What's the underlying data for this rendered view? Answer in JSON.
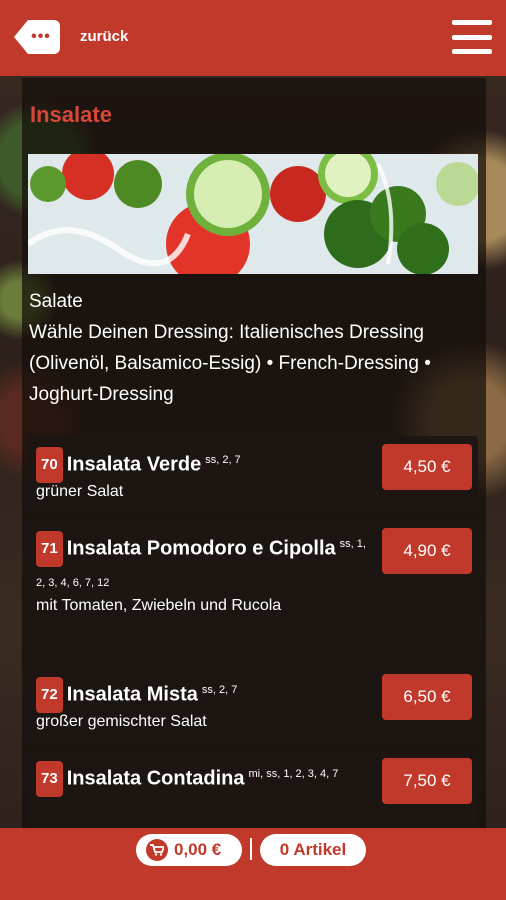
{
  "header": {
    "back_label": "zurück",
    "back_icon_text": "•••"
  },
  "section": {
    "title": "Insalate",
    "description": "Salate\nWähle Deinen Dressing: Italienisches Dressing (Olivenöl, Balsamico-Essig) • French-Dressing • Joghurt-Dressing"
  },
  "items": [
    {
      "number": "70",
      "name": "Insalata Verde",
      "allergens": "ss, 2, 7",
      "description": "grüner Salat",
      "price": "4,50 €"
    },
    {
      "number": "71",
      "name": "Insalata Pomodoro e Cipolla",
      "allergens": "ss, 1, 2, 3, 4, 6, 7, 12",
      "description": "mit Tomaten, Zwiebeln und Rucola",
      "price": "4,90 €"
    },
    {
      "number": "72",
      "name": "Insalata Mista",
      "allergens": "ss, 2, 7",
      "description": "großer gemischter Salat",
      "price": "6,50 €"
    },
    {
      "number": "73",
      "name": "Insalata Contadina",
      "allergens": "mi, ss, 1, 2, 3, 4, 7",
      "description": "",
      "price": "7,50 €"
    }
  ],
  "footer": {
    "cart_total": "0,00 €",
    "cart_count": "0 Artikel"
  },
  "colors": {
    "brand_red": "#c0392b",
    "title_red": "#d9463a"
  }
}
